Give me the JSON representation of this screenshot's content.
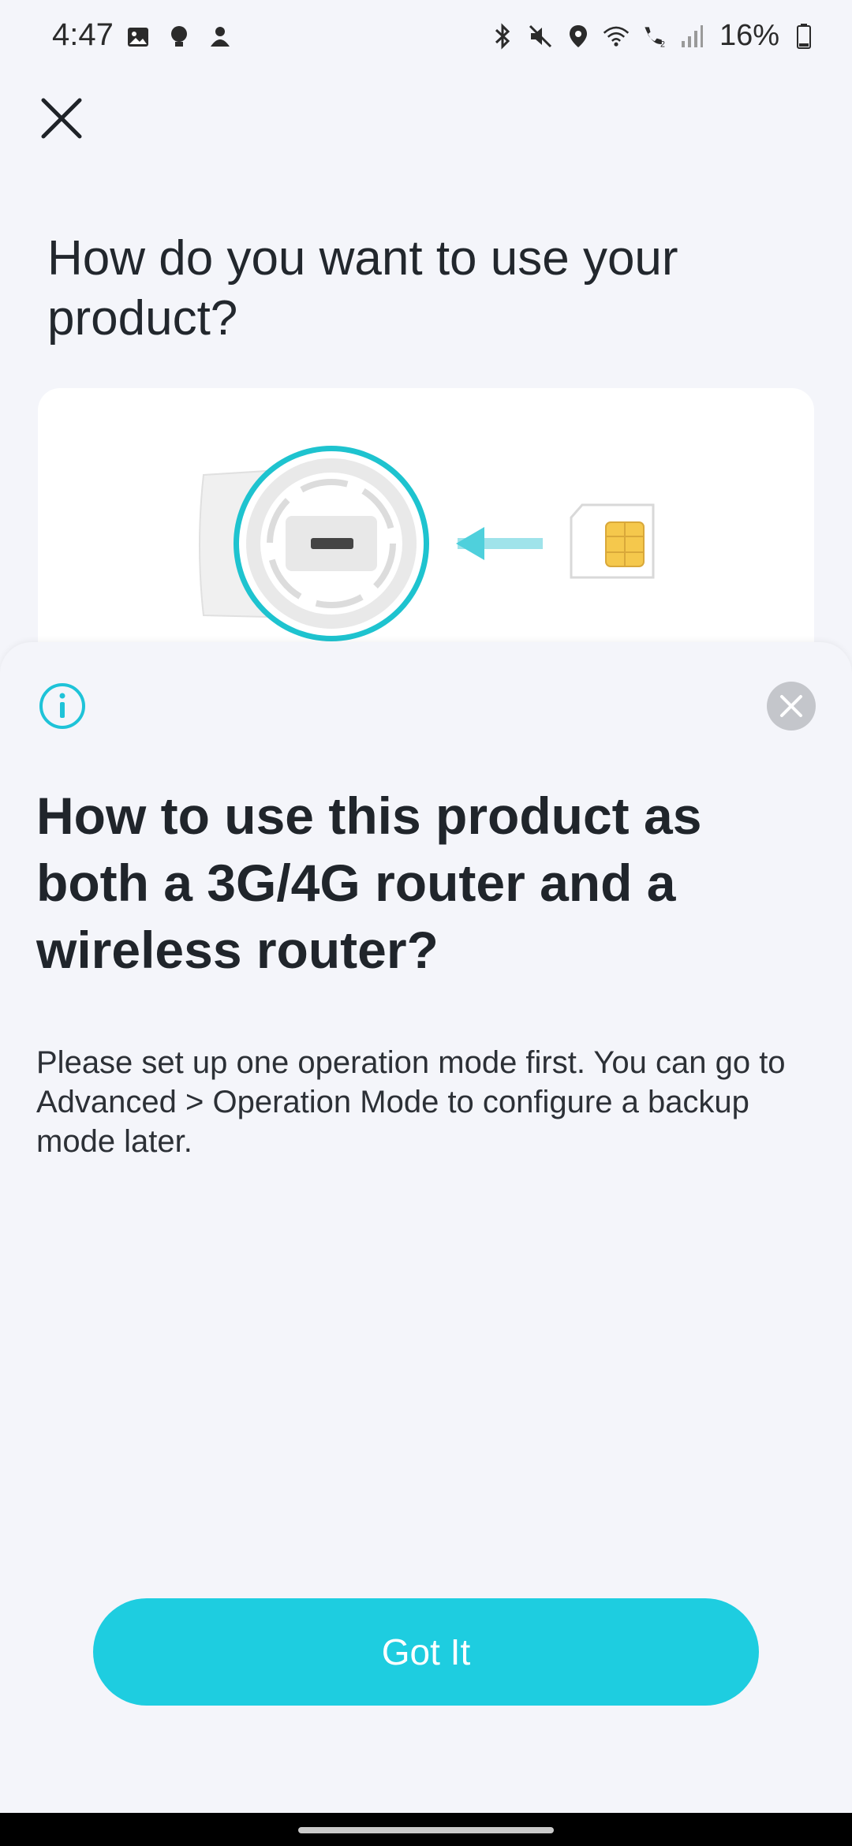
{
  "status_bar": {
    "time": "4:47",
    "battery": "16%",
    "left_icons": [
      "gallery-icon",
      "bulb-icon",
      "gamepad-icon"
    ],
    "right_icons": [
      "bluetooth-icon",
      "mute-icon",
      "location-icon",
      "wifi-icon",
      "wifi-calling-icon",
      "signal-icon",
      "battery-icon"
    ]
  },
  "header": {
    "title": "How do you want to use your product?"
  },
  "sheet": {
    "title": "How to use this product as both a 3G/4G router and a wireless router?",
    "body": "Please set up one operation mode first. You can go to Advanced > Operation Mode to configure a backup mode later.",
    "button_label": "Got It"
  },
  "colors": {
    "accent": "#1ecde0",
    "background": "#f4f5fa",
    "card": "#ffffff"
  }
}
